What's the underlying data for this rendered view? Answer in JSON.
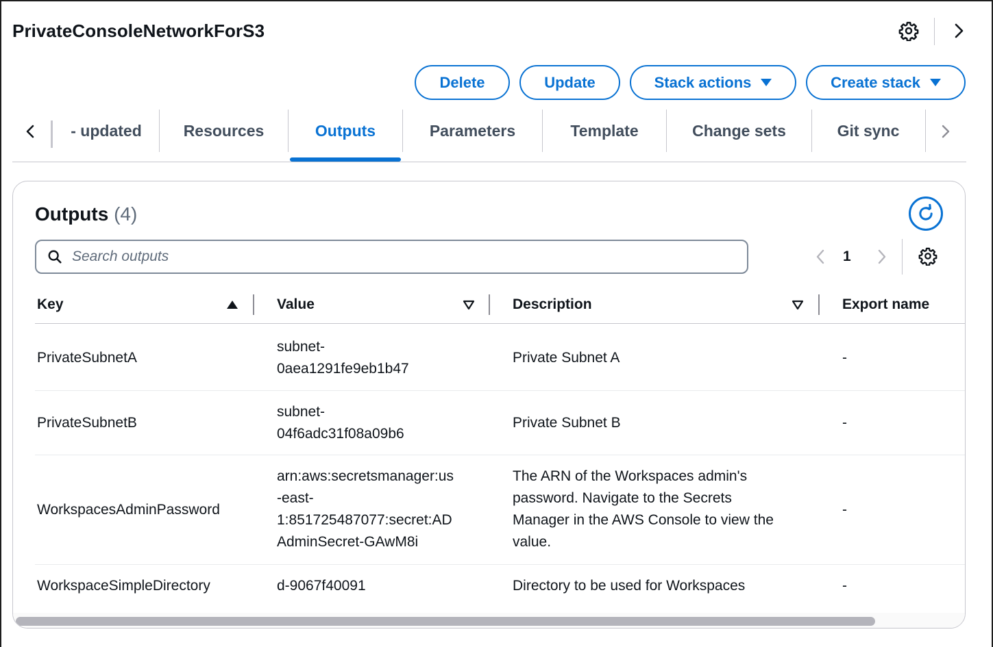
{
  "header": {
    "stack_name": "PrivateConsoleNetworkForS3"
  },
  "actions": {
    "delete": "Delete",
    "update": "Update",
    "stack_actions": "Stack actions",
    "create_stack": "Create stack"
  },
  "tabs": [
    {
      "label": "- updated",
      "active": false
    },
    {
      "label": "Resources",
      "active": false
    },
    {
      "label": "Outputs",
      "active": true
    },
    {
      "label": "Parameters",
      "active": false
    },
    {
      "label": "Template",
      "active": false
    },
    {
      "label": "Change sets",
      "active": false
    },
    {
      "label": "Git sync",
      "active": false
    }
  ],
  "outputs": {
    "title": "Outputs",
    "count": "(4)",
    "search_placeholder": "Search outputs",
    "page": "1",
    "columns": {
      "key": "Key",
      "value": "Value",
      "description": "Description",
      "export_name": "Export name"
    },
    "rows": [
      {
        "key": "PrivateSubnetA",
        "value_lines": [
          "subnet-",
          "0aea1291fe9eb1b47"
        ],
        "description_lines": [
          "Private Subnet A"
        ],
        "export_name": "-"
      },
      {
        "key": "PrivateSubnetB",
        "value_lines": [
          "subnet-",
          "04f6adc31f08a09b6"
        ],
        "description_lines": [
          "Private Subnet B"
        ],
        "export_name": "-"
      },
      {
        "key": "WorkspacesAdminPassword",
        "value_lines": [
          "arn:aws:secretsmanager:us",
          "-east-",
          "1:851725487077:secret:AD",
          "AdminSecret-GAwM8i"
        ],
        "description_lines": [
          "The ARN of the Workspaces admin's",
          "password. Navigate to the Secrets",
          "Manager in the AWS Console to view the",
          "value."
        ],
        "export_name": "-"
      },
      {
        "key": "WorkspaceSimpleDirectory",
        "value_lines": [
          "d-9067f40091"
        ],
        "description_lines": [
          "Directory to be used for Workspaces"
        ],
        "export_name": "-"
      }
    ]
  },
  "icons": {
    "top_settings": "gear-icon",
    "top_expand": "chevron-right-icon",
    "tab_scroll_left": "chevron-left-icon",
    "tab_scroll_right": "chevron-right-icon",
    "refresh": "refresh-icon",
    "search": "search-icon",
    "pager_prev": "chevron-left-icon",
    "pager_next": "chevron-right-icon",
    "table_settings": "gear-icon"
  },
  "colors": {
    "accent": "#0972d3",
    "text": "#0f141a",
    "muted": "#414d5c",
    "border": "#c6c6cd"
  }
}
